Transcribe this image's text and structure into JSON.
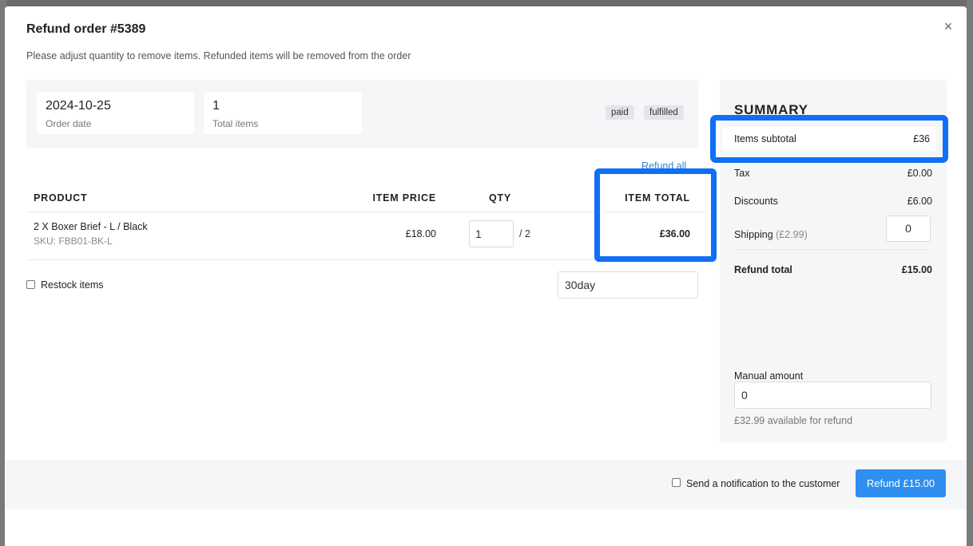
{
  "modal": {
    "title": "Refund order #5389",
    "subtitle": "Please adjust quantity to remove items. Refunded items will be removed from the order",
    "close_icon": "×"
  },
  "order_info": {
    "date_value": "2024-10-25",
    "date_label": "Order date",
    "items_value": "1",
    "items_label": "Total items",
    "badges": [
      "paid",
      "fulfilled"
    ]
  },
  "refund_all_label": "Refund all",
  "table": {
    "headers": {
      "product": "PRODUCT",
      "item_price": "ITEM PRICE",
      "qty": "QTY",
      "item_total": "ITEM TOTAL"
    },
    "rows": [
      {
        "product": "2 X Boxer Brief - L / Black",
        "sku": "SKU: FBB01-BK-L",
        "item_price": "£18.00",
        "qty": "1",
        "qty_max": "/ 2",
        "item_total": "£36.00"
      }
    ]
  },
  "restock_label": "Restock items",
  "reason_value": "30day",
  "summary": {
    "title": "SUMMARY",
    "items_subtotal_label": "Items subtotal",
    "items_subtotal_value": "£36",
    "tax_label": "Tax",
    "tax_value": "£0.00",
    "discounts_label": "Discounts",
    "discounts_value": "£6.00",
    "shipping_label": "Shipping",
    "shipping_hint": "(£2.99)",
    "shipping_value": "0",
    "refund_total_label": "Refund total",
    "refund_total_value": "£15.00",
    "manual_amount_label": "Manual amount",
    "manual_amount_value": "0",
    "available_text": "£32.99 available for refund"
  },
  "footer": {
    "notify_label": "Send a notification to the customer",
    "refund_button_label": "Refund £15.00"
  },
  "colors": {
    "highlight": "#0f6ff5",
    "primary_button": "#2e8ff0",
    "link": "#2f86d9"
  }
}
